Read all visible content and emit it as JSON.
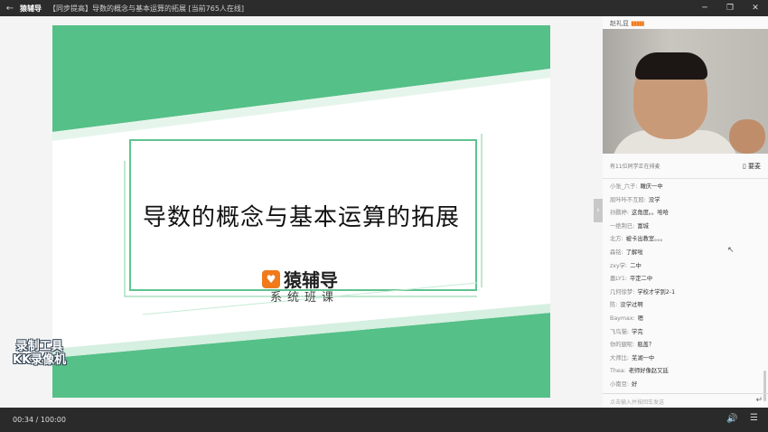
{
  "titlebar": {
    "app_name": "猿辅导",
    "title": "【同步提高】导数的概念与基本运算的拓展 [当前765人在线]",
    "back_icon": "back-arrow-icon",
    "minimize": "─",
    "restore": "❐",
    "close": "✕"
  },
  "slide": {
    "title": "导数的概念与基本运算的拓展",
    "brand_name": "猿辅导",
    "course_label": "系统班课",
    "accent_color": "#55c087"
  },
  "watermark": {
    "line1": "录制工具",
    "line2": "KK录像机"
  },
  "sidebar": {
    "teacher_name": "赵礼显",
    "queue_text": "有11位同学正在排麦",
    "mic_button": "要麦",
    "input_placeholder": "点击输入并按回车发送",
    "messages": [
      {
        "user": "小张_六子:",
        "text": "瞰庆一中"
      },
      {
        "user": "屈咔咔不互殴:",
        "text": "没学"
      },
      {
        "user": "孙鹏婷:",
        "text": "这角度。。哈哈"
      },
      {
        "user": "一绝荆已:",
        "text": "富城"
      },
      {
        "user": "北方:",
        "text": "被卡出教室。。。"
      },
      {
        "user": "森铭:",
        "text": "了解啦"
      },
      {
        "user": "zxy学:",
        "text": "二中"
      },
      {
        "user": "嘉LY1:",
        "text": "平定二中"
      },
      {
        "user": "几何徐梦:",
        "text": "学校才学到2-1"
      },
      {
        "user": "陈:",
        "text": "没学过啊"
      },
      {
        "user": "Baymax:",
        "text": "嗯"
      },
      {
        "user": "飞鸟猫:",
        "text": "学完"
      },
      {
        "user": "你的腿呢:",
        "text": "瓶盖？"
      },
      {
        "user": "大师比:",
        "text": "芜湖一中"
      },
      {
        "user": "Thea:",
        "text": "老师好像赵又廷"
      },
      {
        "user": "小南豆:",
        "text": "好"
      }
    ]
  },
  "controls": {
    "time": "00:34 / 100:00"
  }
}
